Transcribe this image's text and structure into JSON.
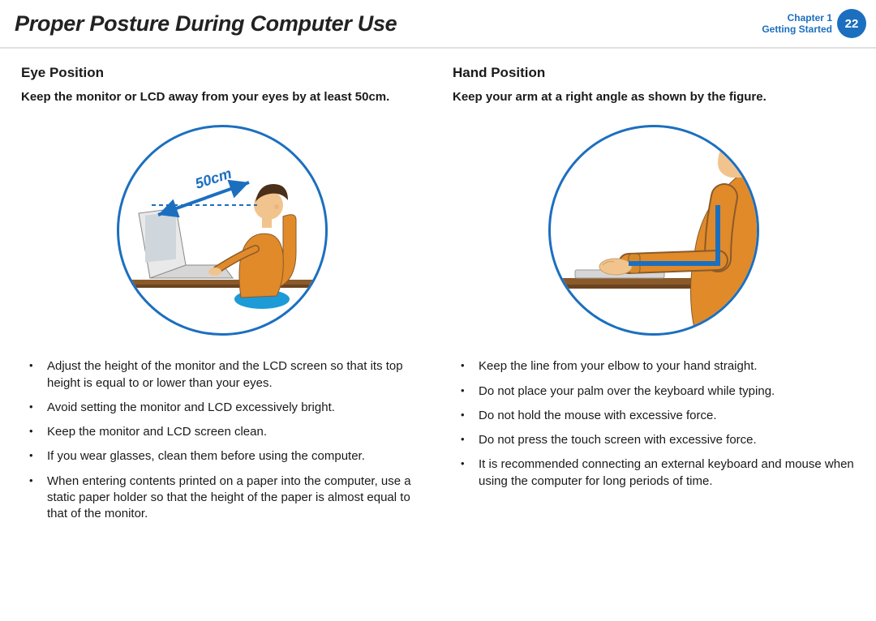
{
  "header": {
    "title": "Proper Posture During Computer Use",
    "chapter_line1": "Chapter 1",
    "chapter_line2": "Getting Started",
    "page_number": "22"
  },
  "left": {
    "heading": "Eye Position",
    "sub": "Keep the monitor or LCD away from your eyes by at least 50cm.",
    "distance_label": "50cm",
    "tips": [
      "Adjust the height of the monitor and the LCD screen so that its top height is equal to or lower than your eyes.",
      "Avoid setting the monitor and LCD excessively bright.",
      "Keep the monitor and LCD screen clean.",
      "If you wear glasses, clean them before using the computer.",
      "When entering contents printed on a paper into the computer, use a static paper holder so that the height of the paper is almost equal to that of the monitor."
    ]
  },
  "right": {
    "heading": "Hand Position",
    "sub": "Keep your arm at a right angle as shown by the figure.",
    "tips": [
      "Keep the line from your elbow to your hand straight.",
      "Do not place your palm over the keyboard while typing.",
      "Do not hold the mouse with excessive force.",
      "Do not press the touch screen with excessive force.",
      "It is recommended connecting an external keyboard and mouse when using the computer for long periods of time."
    ]
  }
}
